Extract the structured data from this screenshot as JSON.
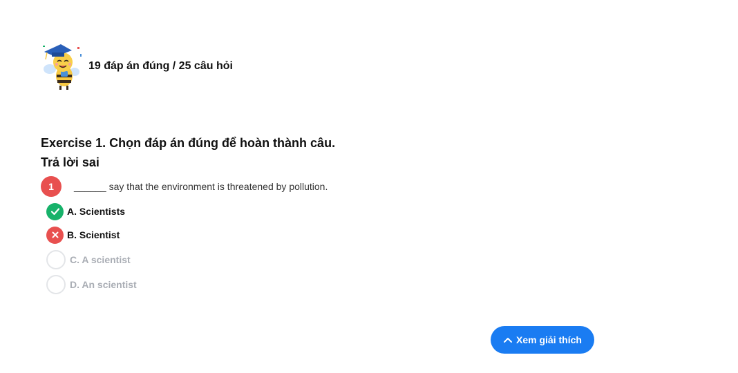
{
  "score": {
    "mascot_icon": "graduate-bee-mascot",
    "text": "19 đáp án đúng / 25 câu hỏi"
  },
  "exercise": {
    "title": "Exercise 1. Chọn đáp án đúng để hoàn thành câu.",
    "result": "Trả lời sai"
  },
  "question": {
    "number": "1",
    "text": "______ say that the environment is threatened by pollution."
  },
  "options": [
    {
      "label": "A. Scientists",
      "state": "correct",
      "icon": "check-icon"
    },
    {
      "label": "B. Scientist",
      "state": "wrong",
      "icon": "close-icon"
    },
    {
      "label": "C. A scientist",
      "state": "unselected",
      "icon": "radio-icon"
    },
    {
      "label": "D. An scientist",
      "state": "unselected",
      "icon": "radio-icon"
    }
  ],
  "explain_button": {
    "label": "Xem giải thích",
    "icon": "chevron-up-icon"
  },
  "colors": {
    "correct": "#17b26a",
    "wrong": "#e8504f",
    "primary": "#1a7cf2",
    "muted": "#a9adb4"
  }
}
